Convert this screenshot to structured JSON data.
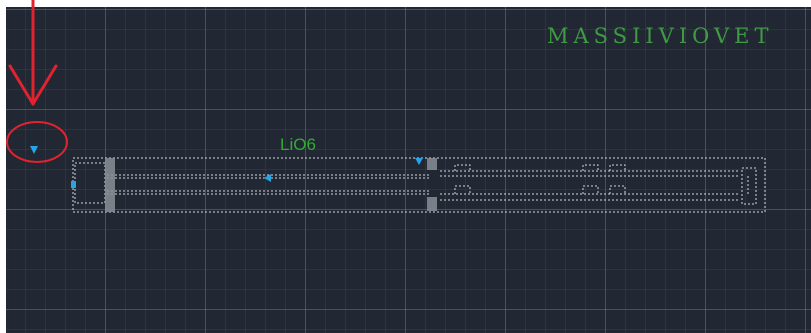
{
  "header": {
    "title": "MASSIIVIOVET"
  },
  "drawing": {
    "block_label": "LiO6"
  },
  "annotations": {
    "arrow_color": "#e0232e",
    "circle_color": "#e0232e"
  },
  "colors": {
    "background": "#212834",
    "grid": "#4a5566",
    "line": "#d8d8d8",
    "grip": "#29a3e8",
    "label": "#2fae2f",
    "title": "#3f9a43"
  }
}
